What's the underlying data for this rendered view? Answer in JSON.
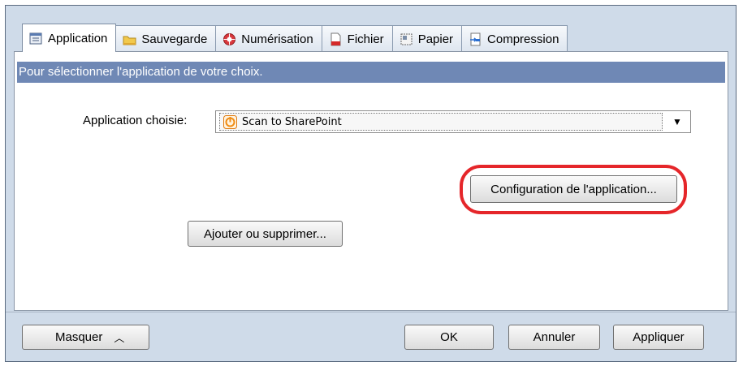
{
  "tabs": [
    {
      "label": "Application",
      "icon": "application-icon",
      "active": true
    },
    {
      "label": "Sauvegarde",
      "icon": "folder-icon",
      "active": false
    },
    {
      "label": "Numérisation",
      "icon": "scan-icon",
      "active": false
    },
    {
      "label": "Fichier",
      "icon": "file-icon",
      "active": false
    },
    {
      "label": "Papier",
      "icon": "paper-icon",
      "active": false
    },
    {
      "label": "Compression",
      "icon": "compression-icon",
      "active": false
    }
  ],
  "panel": {
    "banner": "Pour sélectionner l'application de votre choix.",
    "app_label": "Application choisie:",
    "app_selected": "Scan to SharePoint",
    "config_button": "Configuration de l'application...",
    "add_remove_button": "Ajouter ou supprimer..."
  },
  "footer": {
    "hide_button": "Masquer",
    "ok_button": "OK",
    "cancel_button": "Annuler",
    "apply_button": "Appliquer"
  },
  "colors": {
    "banner": "#6f88b5",
    "window": "#cfdbe9",
    "highlight": "#e5262a"
  }
}
